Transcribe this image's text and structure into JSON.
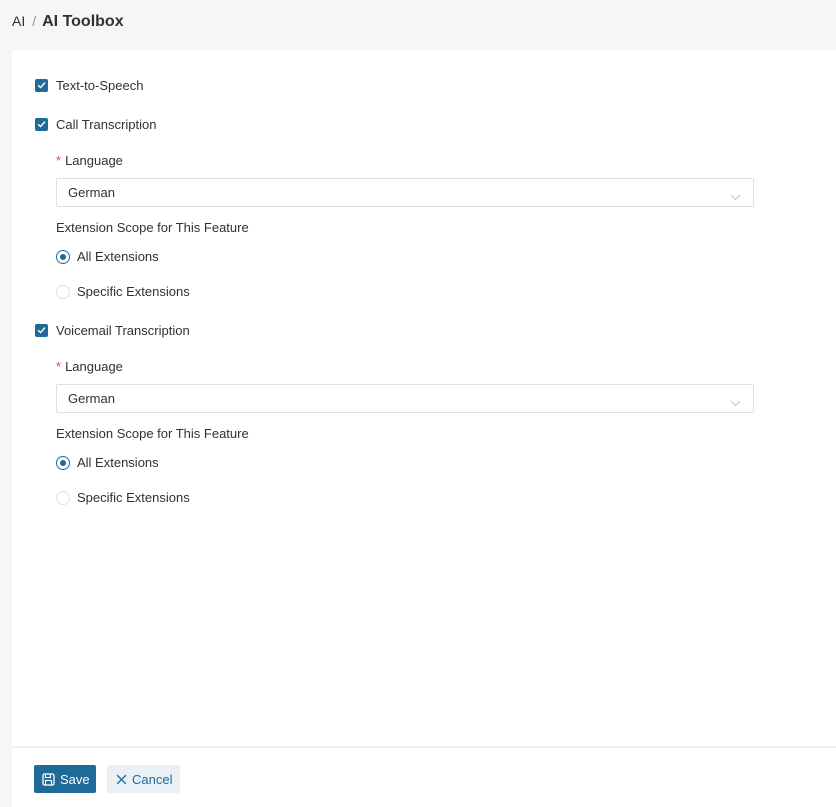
{
  "breadcrumb": {
    "root": "AI",
    "separator": "/",
    "current": "AI Toolbox"
  },
  "features": {
    "tts": {
      "label": "Text-to-Speech",
      "checked": true
    },
    "call": {
      "label": "Call Transcription",
      "checked": true,
      "language_label": "Language",
      "language_value": "German",
      "scope_title": "Extension Scope for This Feature",
      "scope_all": "All Extensions",
      "scope_specific": "Specific Extensions",
      "scope_selected": "All Extensions"
    },
    "voicemail": {
      "label": "Voicemail Transcription",
      "checked": true,
      "language_label": "Language",
      "language_value": "German",
      "scope_title": "Extension Scope for This Feature",
      "scope_all": "All Extensions",
      "scope_specific": "Specific Extensions",
      "scope_selected": "All Extensions"
    }
  },
  "footer": {
    "save_label": "Save",
    "cancel_label": "Cancel"
  },
  "colors": {
    "primary": "#1f6a98",
    "required": "#e5484d",
    "cancel_bg": "#e9f1f7"
  }
}
